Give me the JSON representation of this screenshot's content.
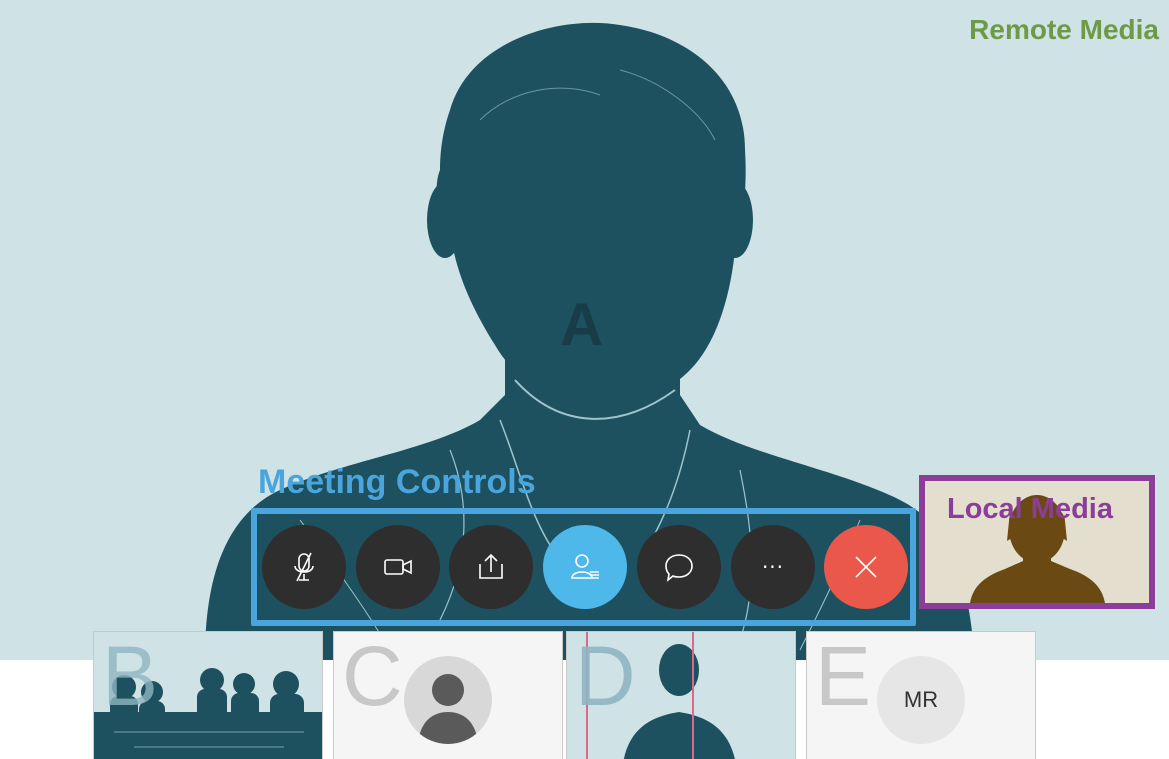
{
  "colors": {
    "remote_bg": "#cfe2e6",
    "silhouette": "#1e5160",
    "silhouette_line": "#9fc4cc",
    "remote_label": "#6e9a47",
    "controls_label": "#4aa5dd",
    "controls_border": "#4aa5dd",
    "button_dark": "#2e2e2e",
    "button_active": "#4fb8ea",
    "button_end": "#e9584a",
    "local_border": "#8a3e97",
    "local_label": "#8a3e97",
    "local_bg": "#e4decf",
    "local_silhouette": "#6a4a12",
    "thumb_bg": "#f5f5f5",
    "thumb_letter": "#c8c8c8",
    "initials_bg": "#e6e6e6",
    "initials_text": "#333333"
  },
  "remote_media": {
    "label": "Remote Media",
    "speaker": "A"
  },
  "meeting_controls": {
    "label": "Meeting Controls",
    "buttons": [
      {
        "name": "mute",
        "icon": "microphone-muted-icon"
      },
      {
        "name": "video",
        "icon": "video-camera-icon"
      },
      {
        "name": "share",
        "icon": "share-upload-icon"
      },
      {
        "name": "participants",
        "icon": "participants-icon",
        "active": true
      },
      {
        "name": "chat",
        "icon": "chat-bubble-icon"
      },
      {
        "name": "more",
        "icon": "more-options-icon",
        "text": "···"
      },
      {
        "name": "end",
        "icon": "close-x-icon"
      }
    ]
  },
  "local_media": {
    "label": "Local Media"
  },
  "participants": [
    {
      "letter": "B",
      "kind": "group-video"
    },
    {
      "letter": "C",
      "kind": "avatar-photo"
    },
    {
      "letter": "D",
      "kind": "person-video"
    },
    {
      "letter": "E",
      "kind": "initials",
      "initials": "MR"
    }
  ]
}
